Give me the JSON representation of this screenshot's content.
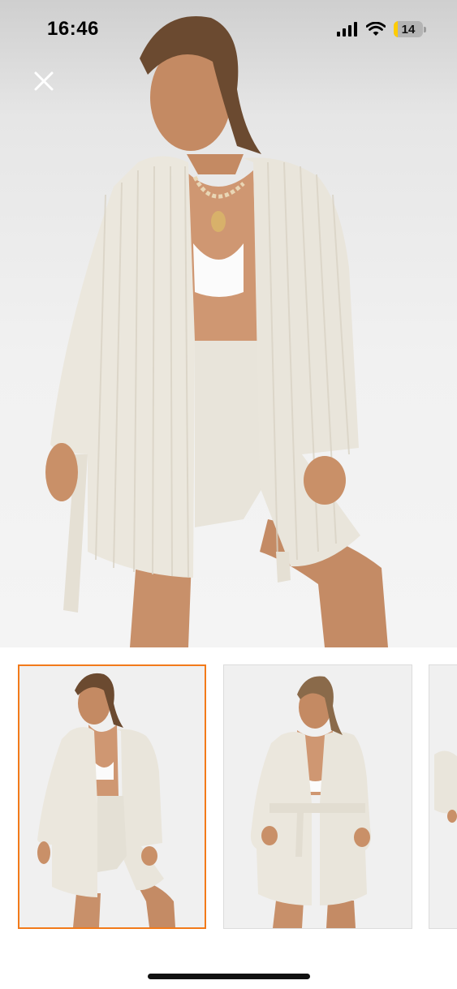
{
  "status_bar": {
    "time": "16:46",
    "battery_level": "14",
    "icons": [
      "signal-icon",
      "wifi-icon",
      "battery-icon"
    ]
  },
  "viewer": {
    "close_icon": "close-icon",
    "main_image": "model-wearing-cream-striped-kimono-cardigan-and-mini-skirt",
    "thumbnails": [
      {
        "image": "model-kimono-open-front-pose",
        "selected": true
      },
      {
        "image": "model-kimono-belted-front-pose",
        "selected": false
      },
      {
        "image": "model-kimono-partial-view",
        "selected": false
      }
    ]
  },
  "colors": {
    "selection_accent": "#f27a1a",
    "background": "#f2f2f2",
    "garment": "#ece8de",
    "battery": "#ffcc00"
  }
}
